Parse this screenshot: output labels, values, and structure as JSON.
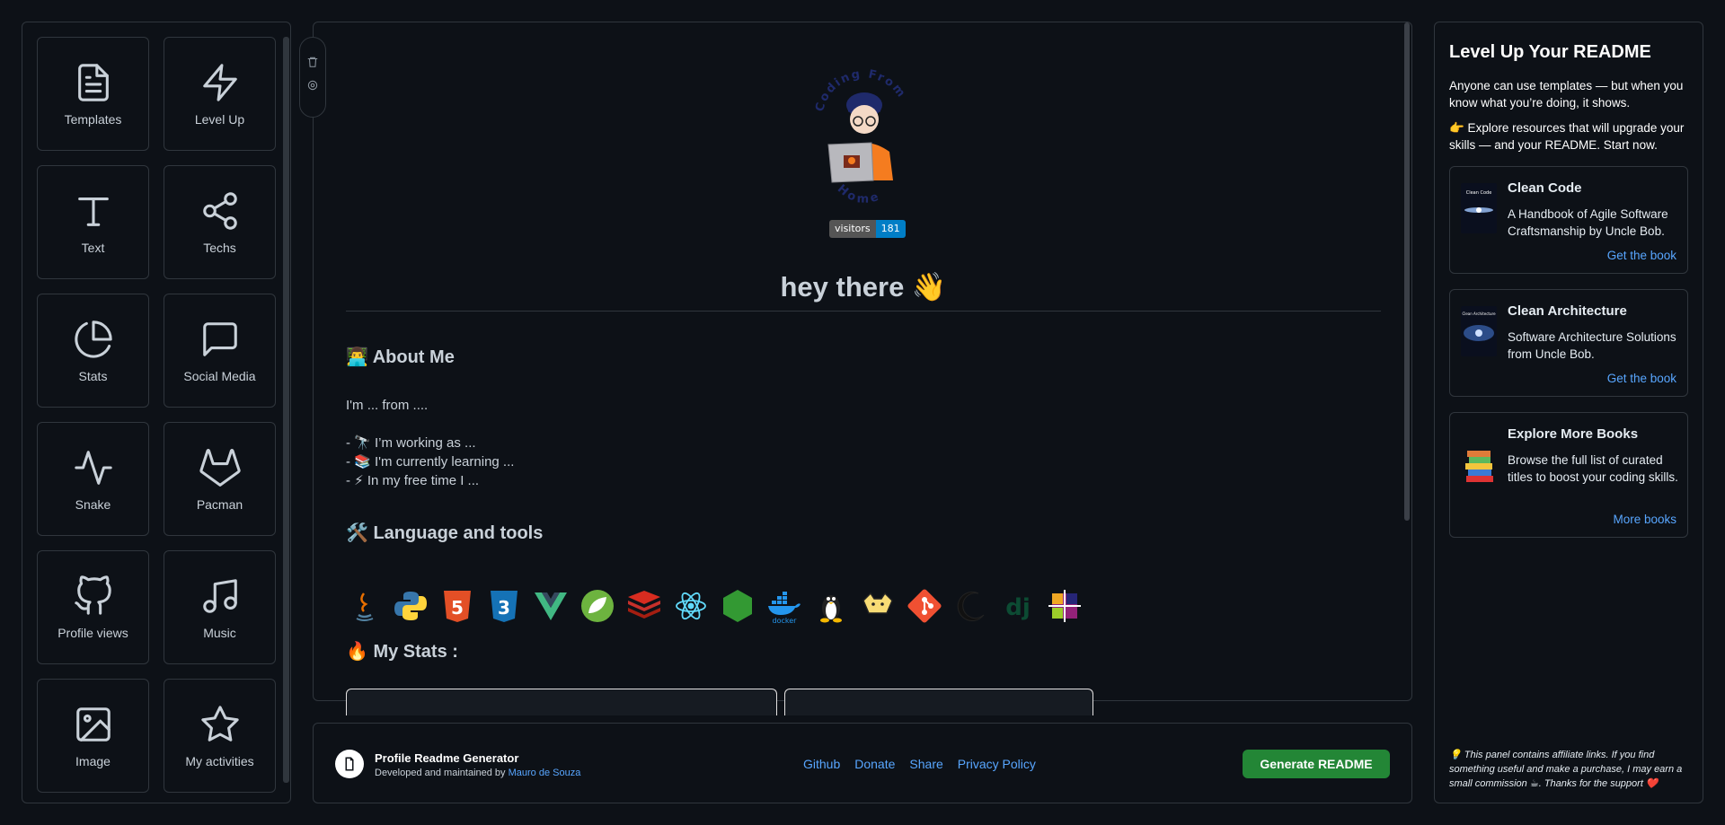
{
  "palette": {
    "items": [
      {
        "label": "Templates",
        "icon": "file-text-icon"
      },
      {
        "label": "Level Up",
        "icon": "lightning-icon"
      },
      {
        "label": "Text",
        "icon": "text-t-icon"
      },
      {
        "label": "Techs",
        "icon": "share-icon"
      },
      {
        "label": "Stats",
        "icon": "pie-chart-icon"
      },
      {
        "label": "Social Media",
        "icon": "message-square-icon"
      },
      {
        "label": "Snake",
        "icon": "activity-icon"
      },
      {
        "label": "Pacman",
        "icon": "gitlab-icon"
      },
      {
        "label": "Profile views",
        "icon": "github-icon"
      },
      {
        "label": "Music",
        "icon": "music-icon"
      },
      {
        "label": "Image",
        "icon": "image-icon"
      },
      {
        "label": "My activities",
        "icon": "star-icon"
      }
    ]
  },
  "preview": {
    "avatar_text_top": "Coding From",
    "avatar_text_bottom": "Home",
    "visitors_label": "visitors",
    "visitors_count": "181",
    "greeting": "hey there 👋",
    "about_heading": "👨‍💻 About Me",
    "about_intro": "I'm ... from ....",
    "about_lines": [
      "- 🔭 I’m working as ...",
      "- 📚 I'm currently learning ...",
      "- ⚡ In my free time I ..."
    ],
    "tools_heading": "🛠️ Language and tools",
    "techs": [
      "java",
      "python",
      "html5",
      "css3",
      "vue",
      "spring",
      "redis",
      "react",
      "nodejs",
      "docker",
      "linux",
      "tomcat",
      "git",
      "eclipse",
      "django",
      "centos"
    ],
    "stats_heading": "🔥 My Stats :"
  },
  "footer": {
    "title": "Profile Readme Generator",
    "sub_prefix": "Developed and maintained by",
    "author": "Mauro de Souza",
    "links": [
      "Github",
      "Donate",
      "Share",
      "Privacy Policy"
    ],
    "generate_label": "Generate README",
    "accent": "#238636"
  },
  "sidebar_right": {
    "title": "Level Up Your README",
    "intro": "Anyone can use templates — but when you know what you’re doing, it shows.",
    "explore": "👉 Explore resources that will upgrade your skills — and your README. Start now.",
    "books": [
      {
        "title": "Clean Code",
        "desc": "A Handbook of Agile Software Craftsmanship by Uncle Bob.",
        "link": "Get the book",
        "cover_label": "Clean Code"
      },
      {
        "title": "Clean Architecture",
        "desc": "Software Architecture Solutions from Uncle Bob.",
        "link": "Get the book",
        "cover_label": "Clean Architecture"
      },
      {
        "title": "Explore More Books",
        "desc": "Browse the full list of curated titles to boost your coding skills.",
        "link": "More books"
      }
    ],
    "affiliate_note": "💡 This panel contains affiliate links. If you find something useful and make a purchase, I may earn a small commission ☕. Thanks for the support ❤️"
  }
}
